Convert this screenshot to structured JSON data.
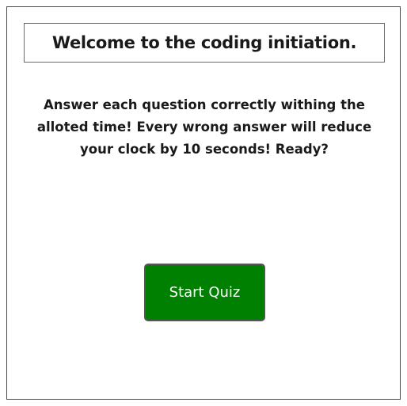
{
  "quiz": {
    "title": "Welcome to the coding initiation.",
    "instructions": "Answer each question correctly withing the alloted time! Every wrong answer will reduce your clock by 10 seconds! Ready?",
    "start_button_label": "Start Quiz"
  },
  "colors": {
    "start_button_bg": "#008000",
    "start_button_text": "#ffffff",
    "card_border": "#4a4a4a",
    "title_border": "#6b6b6b"
  }
}
